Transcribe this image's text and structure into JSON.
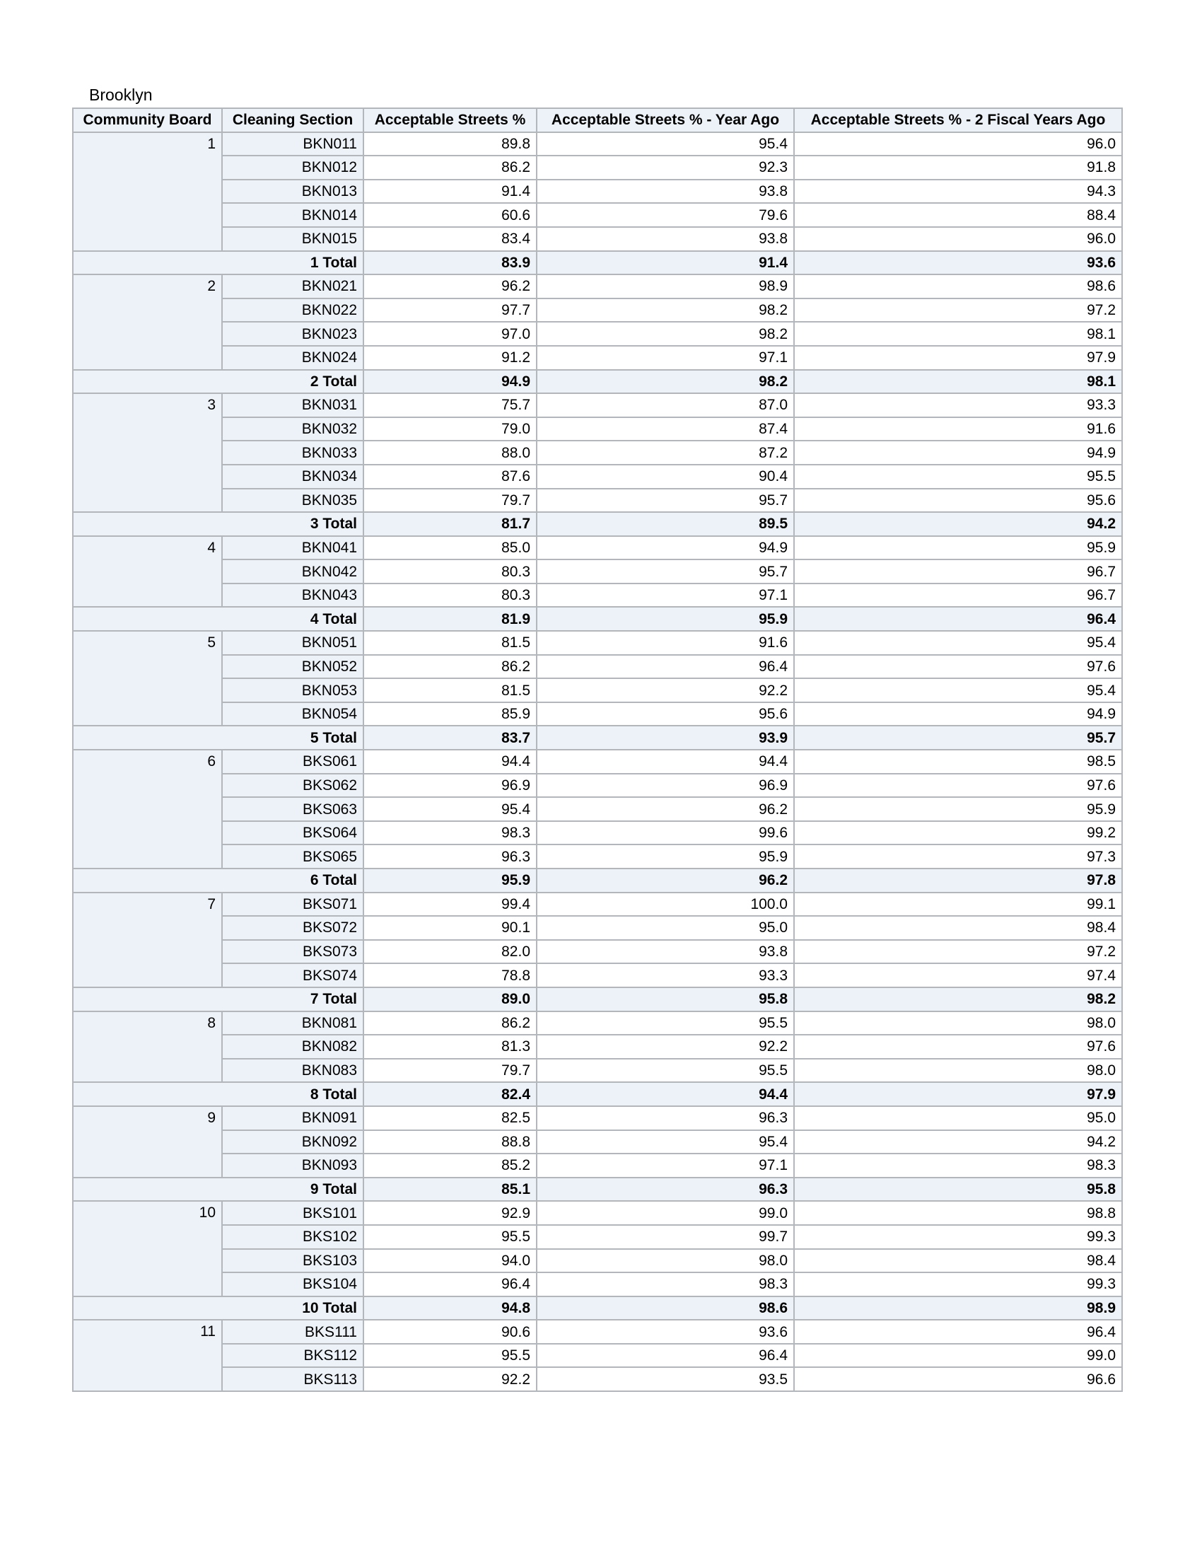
{
  "borough": "Brooklyn",
  "columns": [
    "Community Board",
    "Cleaning Section",
    "Acceptable Streets %",
    "Acceptable Streets % - Year Ago",
    "Acceptable Streets % - 2 Fiscal Years Ago"
  ],
  "groups": [
    {
      "board": "1",
      "rows": [
        {
          "section": "BKN011",
          "pct": "89.8",
          "year_ago": "95.4",
          "two_years_ago": "96.0"
        },
        {
          "section": "BKN012",
          "pct": "86.2",
          "year_ago": "92.3",
          "two_years_ago": "91.8"
        },
        {
          "section": "BKN013",
          "pct": "91.4",
          "year_ago": "93.8",
          "two_years_ago": "94.3"
        },
        {
          "section": "BKN014",
          "pct": "60.6",
          "year_ago": "79.6",
          "two_years_ago": "88.4"
        },
        {
          "section": "BKN015",
          "pct": "83.4",
          "year_ago": "93.8",
          "two_years_ago": "96.0"
        }
      ],
      "total": {
        "label": "1 Total",
        "pct": "83.9",
        "year_ago": "91.4",
        "two_years_ago": "93.6"
      }
    },
    {
      "board": "2",
      "rows": [
        {
          "section": "BKN021",
          "pct": "96.2",
          "year_ago": "98.9",
          "two_years_ago": "98.6"
        },
        {
          "section": "BKN022",
          "pct": "97.7",
          "year_ago": "98.2",
          "two_years_ago": "97.2"
        },
        {
          "section": "BKN023",
          "pct": "97.0",
          "year_ago": "98.2",
          "two_years_ago": "98.1"
        },
        {
          "section": "BKN024",
          "pct": "91.2",
          "year_ago": "97.1",
          "two_years_ago": "97.9"
        }
      ],
      "total": {
        "label": "2 Total",
        "pct": "94.9",
        "year_ago": "98.2",
        "two_years_ago": "98.1"
      }
    },
    {
      "board": "3",
      "rows": [
        {
          "section": "BKN031",
          "pct": "75.7",
          "year_ago": "87.0",
          "two_years_ago": "93.3"
        },
        {
          "section": "BKN032",
          "pct": "79.0",
          "year_ago": "87.4",
          "two_years_ago": "91.6"
        },
        {
          "section": "BKN033",
          "pct": "88.0",
          "year_ago": "87.2",
          "two_years_ago": "94.9"
        },
        {
          "section": "BKN034",
          "pct": "87.6",
          "year_ago": "90.4",
          "two_years_ago": "95.5"
        },
        {
          "section": "BKN035",
          "pct": "79.7",
          "year_ago": "95.7",
          "two_years_ago": "95.6"
        }
      ],
      "total": {
        "label": "3 Total",
        "pct": "81.7",
        "year_ago": "89.5",
        "two_years_ago": "94.2"
      }
    },
    {
      "board": "4",
      "rows": [
        {
          "section": "BKN041",
          "pct": "85.0",
          "year_ago": "94.9",
          "two_years_ago": "95.9"
        },
        {
          "section": "BKN042",
          "pct": "80.3",
          "year_ago": "95.7",
          "two_years_ago": "96.7"
        },
        {
          "section": "BKN043",
          "pct": "80.3",
          "year_ago": "97.1",
          "two_years_ago": "96.7"
        }
      ],
      "total": {
        "label": "4 Total",
        "pct": "81.9",
        "year_ago": "95.9",
        "two_years_ago": "96.4"
      }
    },
    {
      "board": "5",
      "rows": [
        {
          "section": "BKN051",
          "pct": "81.5",
          "year_ago": "91.6",
          "two_years_ago": "95.4"
        },
        {
          "section": "BKN052",
          "pct": "86.2",
          "year_ago": "96.4",
          "two_years_ago": "97.6"
        },
        {
          "section": "BKN053",
          "pct": "81.5",
          "year_ago": "92.2",
          "two_years_ago": "95.4"
        },
        {
          "section": "BKN054",
          "pct": "85.9",
          "year_ago": "95.6",
          "two_years_ago": "94.9"
        }
      ],
      "total": {
        "label": "5 Total",
        "pct": "83.7",
        "year_ago": "93.9",
        "two_years_ago": "95.7"
      }
    },
    {
      "board": "6",
      "rows": [
        {
          "section": "BKS061",
          "pct": "94.4",
          "year_ago": "94.4",
          "two_years_ago": "98.5"
        },
        {
          "section": "BKS062",
          "pct": "96.9",
          "year_ago": "96.9",
          "two_years_ago": "97.6"
        },
        {
          "section": "BKS063",
          "pct": "95.4",
          "year_ago": "96.2",
          "two_years_ago": "95.9"
        },
        {
          "section": "BKS064",
          "pct": "98.3",
          "year_ago": "99.6",
          "two_years_ago": "99.2"
        },
        {
          "section": "BKS065",
          "pct": "96.3",
          "year_ago": "95.9",
          "two_years_ago": "97.3"
        }
      ],
      "total": {
        "label": "6 Total",
        "pct": "95.9",
        "year_ago": "96.2",
        "two_years_ago": "97.8"
      }
    },
    {
      "board": "7",
      "rows": [
        {
          "section": "BKS071",
          "pct": "99.4",
          "year_ago": "100.0",
          "two_years_ago": "99.1"
        },
        {
          "section": "BKS072",
          "pct": "90.1",
          "year_ago": "95.0",
          "two_years_ago": "98.4"
        },
        {
          "section": "BKS073",
          "pct": "82.0",
          "year_ago": "93.8",
          "two_years_ago": "97.2"
        },
        {
          "section": "BKS074",
          "pct": "78.8",
          "year_ago": "93.3",
          "two_years_ago": "97.4"
        }
      ],
      "total": {
        "label": "7 Total",
        "pct": "89.0",
        "year_ago": "95.8",
        "two_years_ago": "98.2"
      }
    },
    {
      "board": "8",
      "rows": [
        {
          "section": "BKN081",
          "pct": "86.2",
          "year_ago": "95.5",
          "two_years_ago": "98.0"
        },
        {
          "section": "BKN082",
          "pct": "81.3",
          "year_ago": "92.2",
          "two_years_ago": "97.6"
        },
        {
          "section": "BKN083",
          "pct": "79.7",
          "year_ago": "95.5",
          "two_years_ago": "98.0"
        }
      ],
      "total": {
        "label": "8 Total",
        "pct": "82.4",
        "year_ago": "94.4",
        "two_years_ago": "97.9"
      }
    },
    {
      "board": "9",
      "rows": [
        {
          "section": "BKN091",
          "pct": "82.5",
          "year_ago": "96.3",
          "two_years_ago": "95.0"
        },
        {
          "section": "BKN092",
          "pct": "88.8",
          "year_ago": "95.4",
          "two_years_ago": "94.2"
        },
        {
          "section": "BKN093",
          "pct": "85.2",
          "year_ago": "97.1",
          "two_years_ago": "98.3"
        }
      ],
      "total": {
        "label": "9 Total",
        "pct": "85.1",
        "year_ago": "96.3",
        "two_years_ago": "95.8"
      }
    },
    {
      "board": "10",
      "rows": [
        {
          "section": "BKS101",
          "pct": "92.9",
          "year_ago": "99.0",
          "two_years_ago": "98.8"
        },
        {
          "section": "BKS102",
          "pct": "95.5",
          "year_ago": "99.7",
          "two_years_ago": "99.3"
        },
        {
          "section": "BKS103",
          "pct": "94.0",
          "year_ago": "98.0",
          "two_years_ago": "98.4"
        },
        {
          "section": "BKS104",
          "pct": "96.4",
          "year_ago": "98.3",
          "two_years_ago": "99.3"
        }
      ],
      "total": {
        "label": "10 Total",
        "pct": "94.8",
        "year_ago": "98.6",
        "two_years_ago": "98.9"
      }
    },
    {
      "board": "11",
      "rows": [
        {
          "section": "BKS111",
          "pct": "90.6",
          "year_ago": "93.6",
          "two_years_ago": "96.4"
        },
        {
          "section": "BKS112",
          "pct": "95.5",
          "year_ago": "96.4",
          "two_years_ago": "99.0"
        },
        {
          "section": "BKS113",
          "pct": "92.2",
          "year_ago": "93.5",
          "two_years_ago": "96.6"
        }
      ]
    }
  ]
}
